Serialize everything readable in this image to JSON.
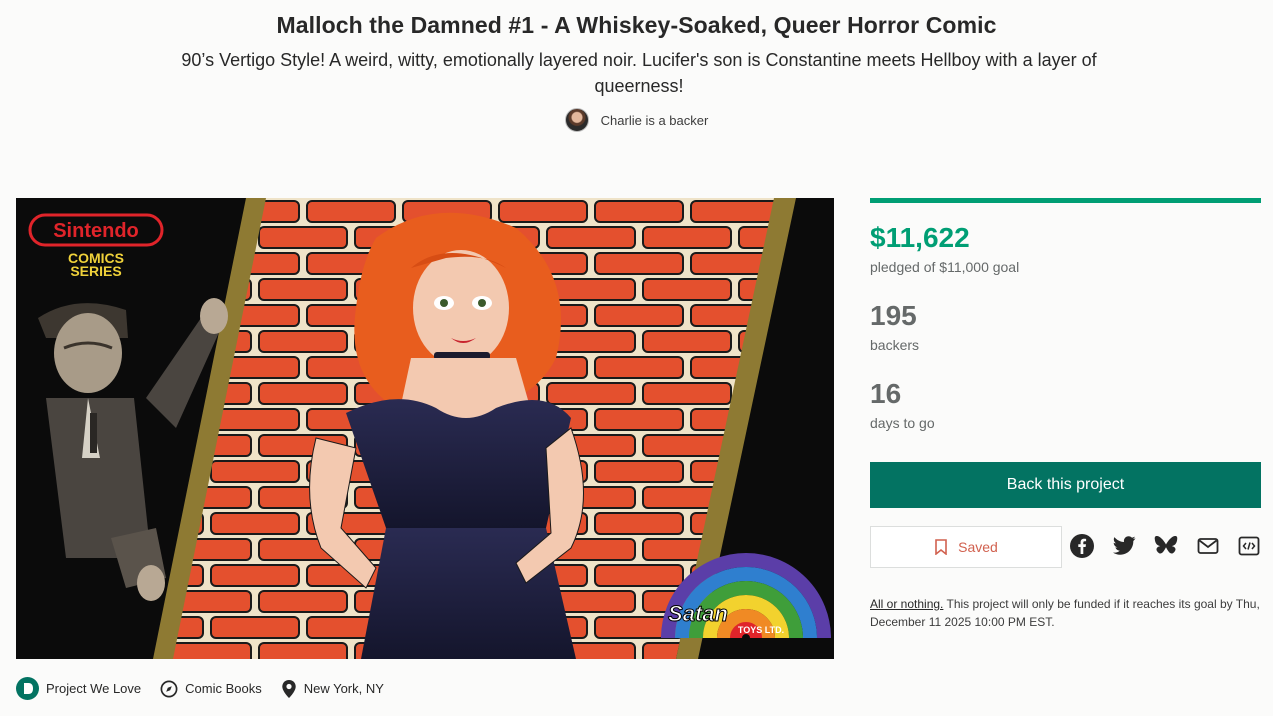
{
  "project": {
    "title": "Malloch the Damned #1 - A Whiskey-Soaked, Queer Horror Comic",
    "blurb": "90’s Vertigo Style! A weird, witty, emotionally layered noir. Lucifer's son is Constantine meets Hellboy with a layer of queerness!",
    "backer_note": "Charlie is a backer"
  },
  "cover_art": {
    "brand": "Sintendo",
    "series_line1": "COMICS",
    "series_line2": "SERIES",
    "publisher": "Satan",
    "publisher_suffix": "TOYS LTD."
  },
  "stats": {
    "pledged": "$11,622",
    "pledged_label": "pledged of $11,000 goal",
    "funding_fraction": 1.0,
    "backers": "195",
    "backers_label": "backers",
    "days": "16",
    "days_label": "days to go"
  },
  "actions": {
    "back_label": "Back this project",
    "saved_label": "Saved",
    "share_icons": [
      "facebook-icon",
      "twitter-icon",
      "bluesky-icon",
      "email-icon",
      "embed-icon"
    ]
  },
  "funding_terms": {
    "link": "All or nothing.",
    "text": " This project will only be funded if it reaches its goal by Thu, December 11 2025 10:00 PM EST."
  },
  "tags": {
    "badge": "Project We Love",
    "category": "Comic Books",
    "location": "New York, NY"
  },
  "colors": {
    "accent_green": "#009e74",
    "button_green": "#037362",
    "saved_red": "#d1614f",
    "muted": "#656969"
  }
}
